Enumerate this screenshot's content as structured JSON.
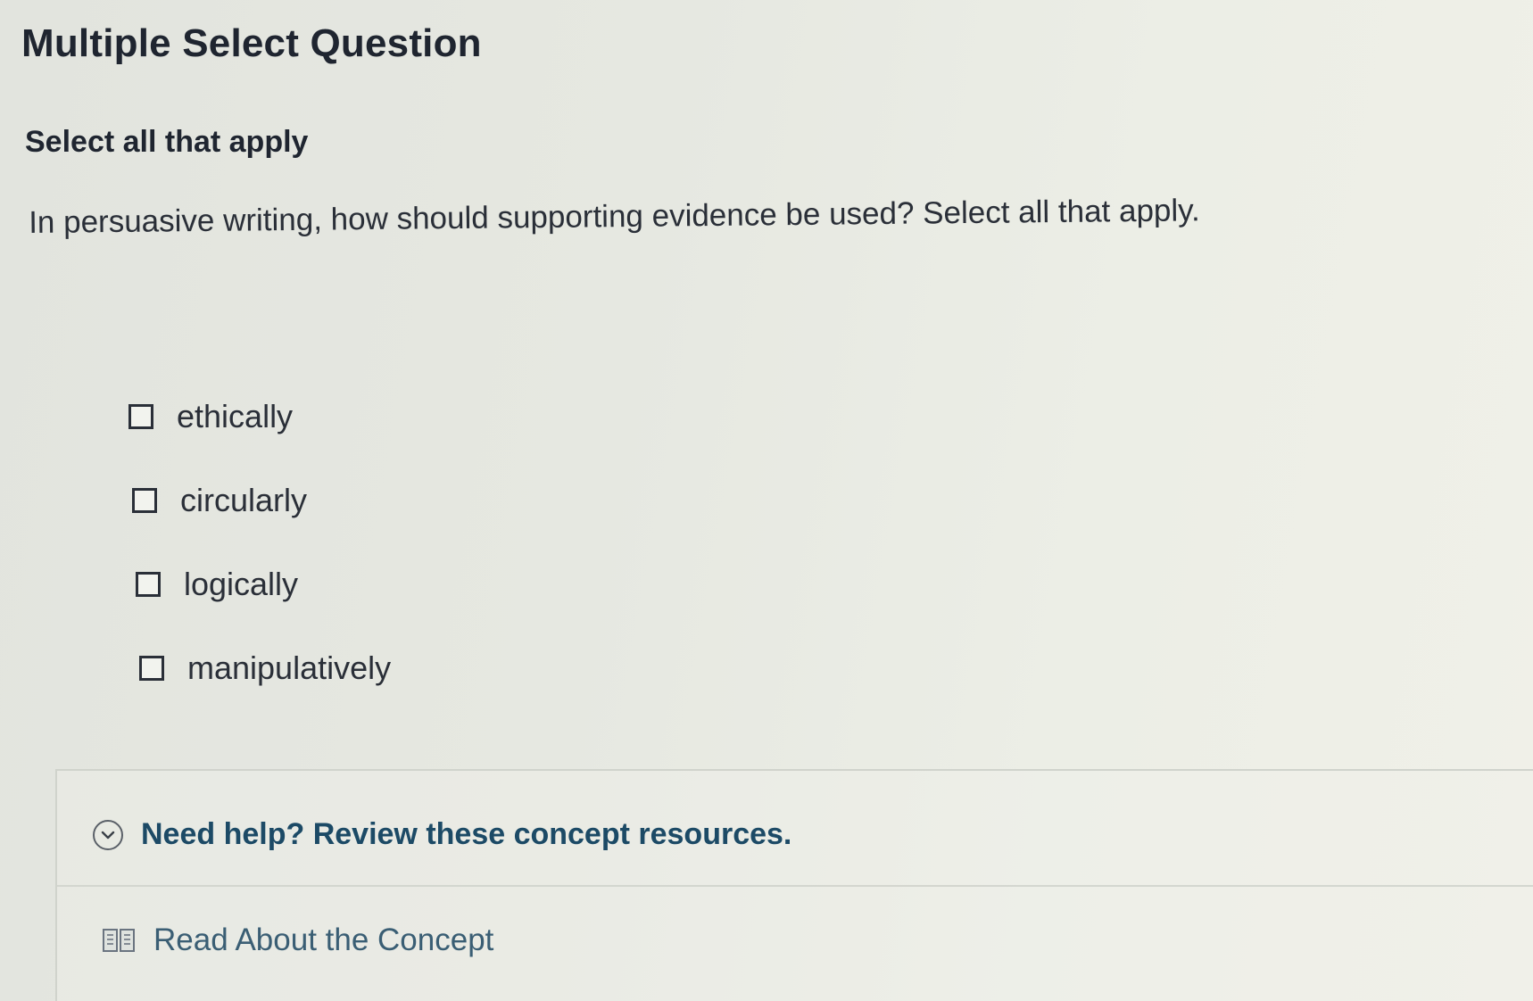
{
  "page_title": "Multiple Select Question",
  "instruction": "Select all that apply",
  "question": "In persuasive writing, how should supporting evidence be used? Select all that apply.",
  "options": [
    {
      "label": "ethically",
      "checked": false
    },
    {
      "label": "circularly",
      "checked": false
    },
    {
      "label": "logically",
      "checked": false
    },
    {
      "label": "manipulatively",
      "checked": false
    }
  ],
  "help": {
    "toggle_label": "Need help? Review these concept resources.",
    "toggle_icon": "chevron-down-circle-icon",
    "resource_label": "Read About the Concept",
    "resource_icon": "book-icon"
  },
  "colors": {
    "link": "#1c4a66",
    "text": "#2a2f38"
  }
}
